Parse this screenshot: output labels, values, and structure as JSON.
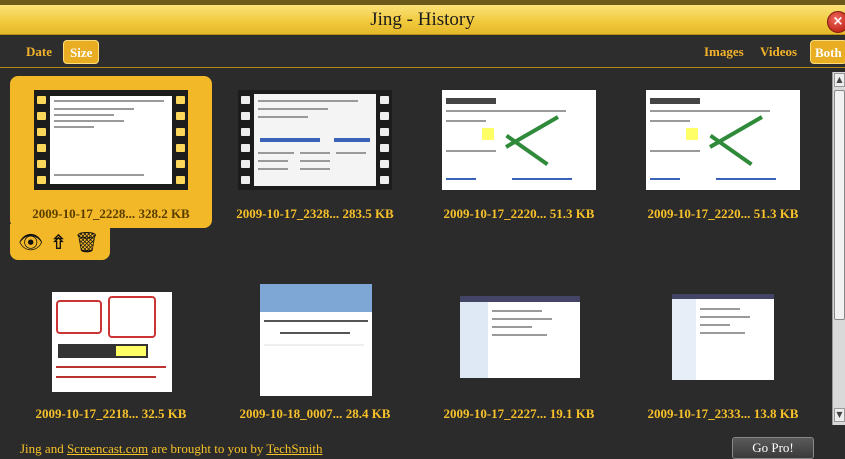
{
  "window": {
    "title": "Jing - History",
    "close_glyph": "×"
  },
  "sort": {
    "date_label": "Date",
    "size_label": "Size",
    "active": "Size"
  },
  "filter": {
    "images_label": "Images",
    "videos_label": "Videos",
    "both_label": "Both",
    "active": "Both"
  },
  "items": [
    {
      "name": "2009-10-17_2228...",
      "size": "328.2 KB",
      "type": "video",
      "selected": true
    },
    {
      "name": "2009-10-17_2328...",
      "size": "283.5 KB",
      "type": "video"
    },
    {
      "name": "2009-10-17_2220...",
      "size": "51.3 KB",
      "type": "image"
    },
    {
      "name": "2009-10-17_2220...",
      "size": "51.3 KB",
      "type": "image"
    },
    {
      "name": "2009-10-17_2218...",
      "size": "32.5 KB",
      "type": "image"
    },
    {
      "name": "2009-10-18_0007...",
      "size": "28.4 KB",
      "type": "image"
    },
    {
      "name": "2009-10-17_2227...",
      "size": "19.1 KB",
      "type": "image"
    },
    {
      "name": "2009-10-17_2333...",
      "size": "13.8 KB",
      "type": "image"
    }
  ],
  "footer": {
    "prefix": "Jing and ",
    "link1": "Screencast.com",
    "middle": " are brought to you by ",
    "link2": "TechSmith"
  },
  "gopro_label": "Go Pro!",
  "icons": {
    "view": "eye-icon",
    "share": "share-icon",
    "delete": "trash-icon"
  },
  "colors": {
    "accent": "#f3b828",
    "caption": "#f7c12a",
    "titlebar": "#f0c93a"
  }
}
